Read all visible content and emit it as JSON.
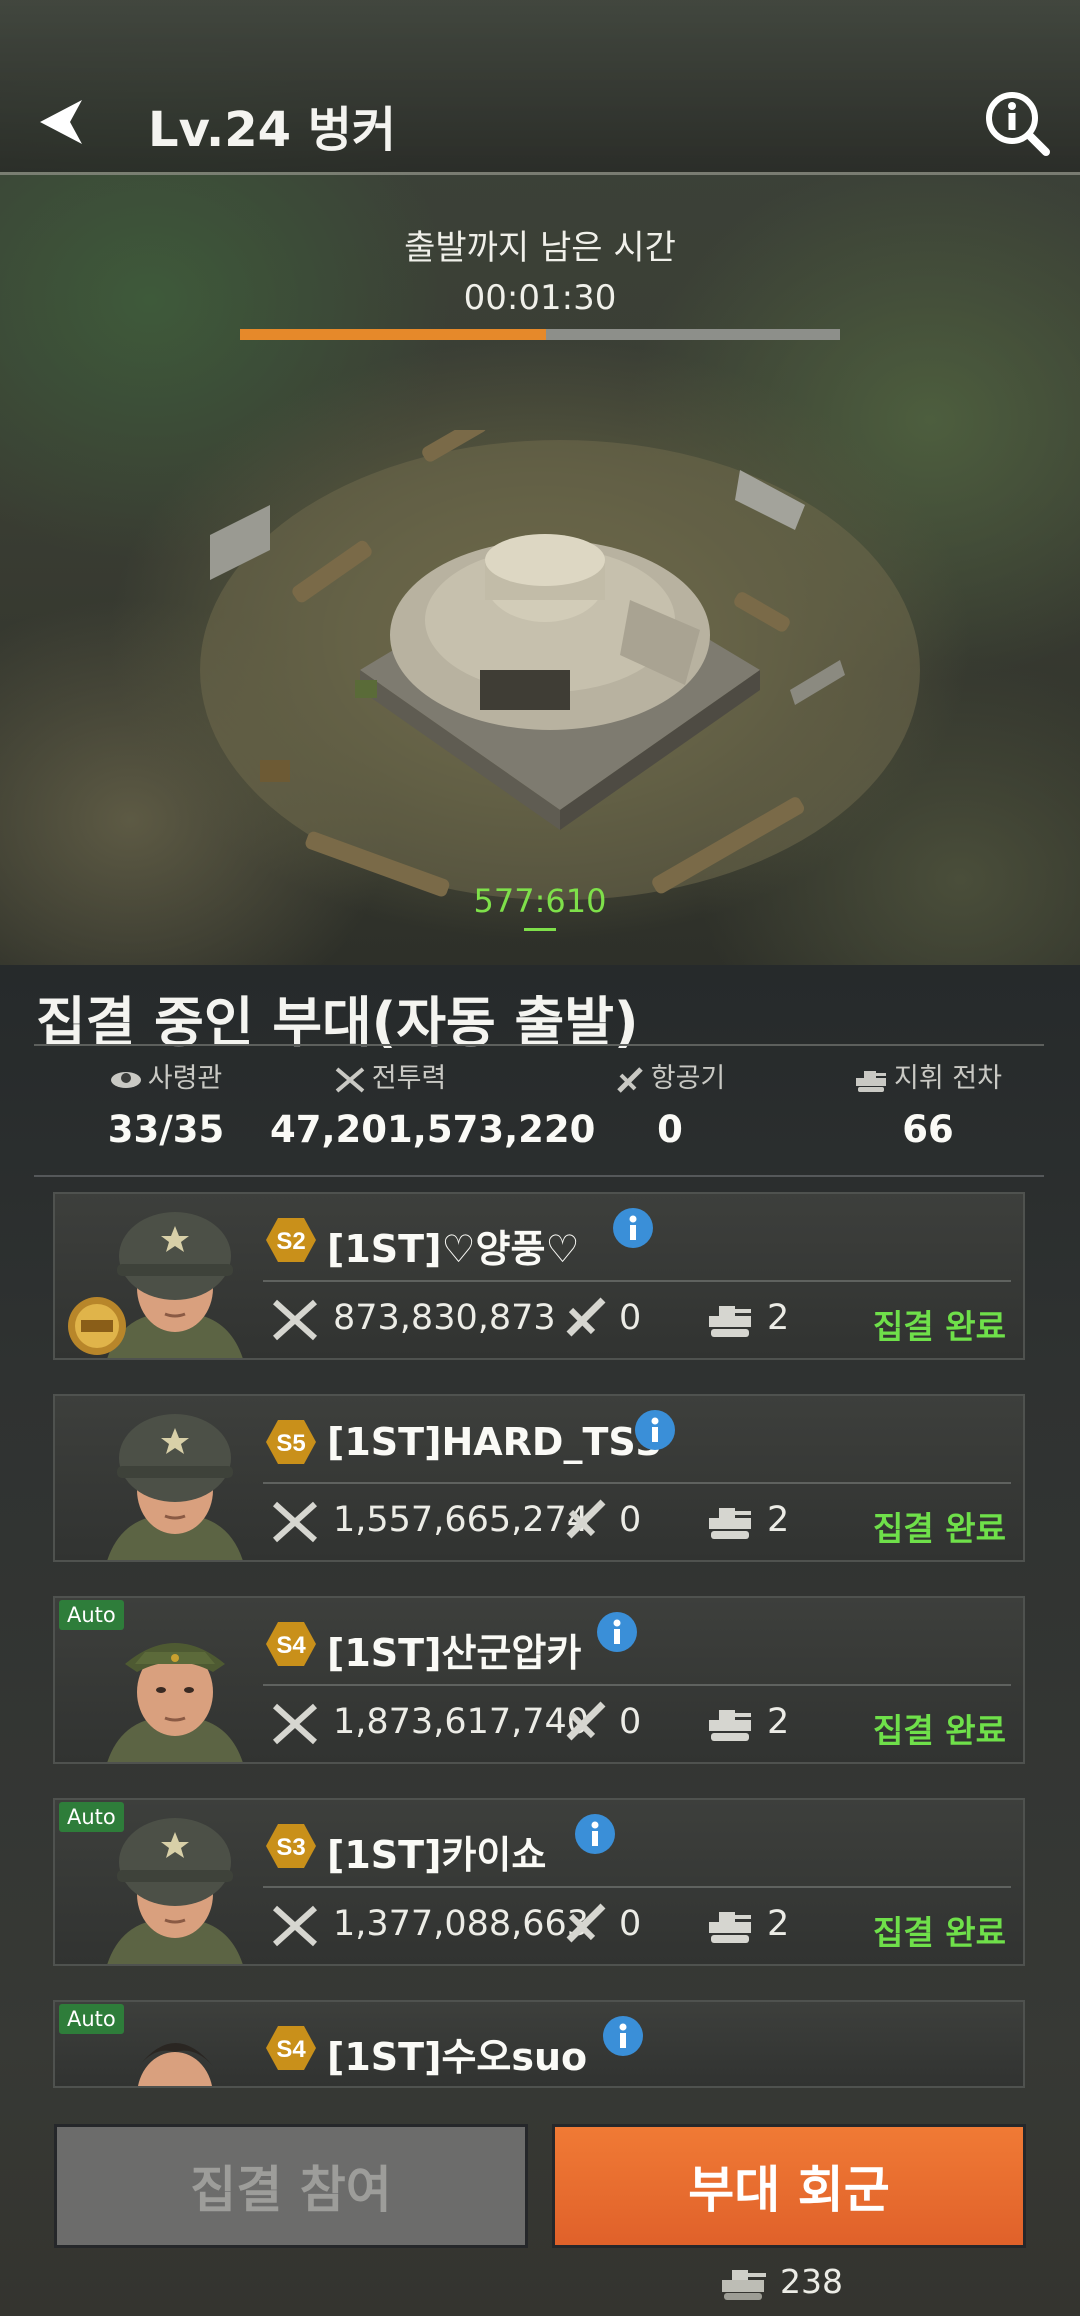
{
  "header": {
    "title": "Lv.24 벙커"
  },
  "rally_timer": {
    "label": "출발까지 남은 시간",
    "value": "00:01:30",
    "progress": 0.51
  },
  "map": {
    "coordinates": "577:610"
  },
  "section": {
    "title": "집결 중인 부대(자동 출발)",
    "stats": [
      {
        "label": "사령관",
        "value": "33/35",
        "icon": "commander-icon"
      },
      {
        "label": "전투력",
        "value": "47,201,573,220",
        "icon": "power-icon"
      },
      {
        "label": "항공기",
        "value": "0",
        "icon": "aircraft-icon"
      },
      {
        "label": "지휘 전차",
        "value": "66",
        "icon": "tank-icon"
      }
    ]
  },
  "members": [
    {
      "rank": "S2",
      "name": "[1ST]♡양풍♡",
      "power": "873,830,873",
      "aircraft": "0",
      "tanks": "2",
      "status": "집결 완료",
      "auto": false,
      "medal": true
    },
    {
      "rank": "S5",
      "name": "[1ST]HARD_TS3",
      "power": "1,557,665,274",
      "aircraft": "0",
      "tanks": "2",
      "status": "집결 완료",
      "auto": false,
      "medal": false
    },
    {
      "rank": "S4",
      "name": "[1ST]산군압카",
      "power": "1,873,617,740",
      "aircraft": "0",
      "tanks": "2",
      "status": "집결 완료",
      "auto": true,
      "auto_label": "Auto",
      "medal": false
    },
    {
      "rank": "S3",
      "name": "[1ST]카이쇼",
      "power": "1,377,088,663",
      "aircraft": "0",
      "tanks": "2",
      "status": "집결 완료",
      "auto": true,
      "auto_label": "Auto",
      "medal": false
    },
    {
      "rank": "S4",
      "name": "[1ST]수오suo",
      "auto": true,
      "auto_label": "Auto",
      "medal": false
    }
  ],
  "buttons": {
    "join": "집결 참여",
    "recall": "부대 회군"
  },
  "troops": {
    "count": "238"
  },
  "colors": {
    "accent_orange": "#e6892a",
    "status_green": "#6fe04a",
    "button_orange": "#e8692e",
    "auto_green": "#2e7d3a",
    "rank_gold": "#c9901a"
  }
}
